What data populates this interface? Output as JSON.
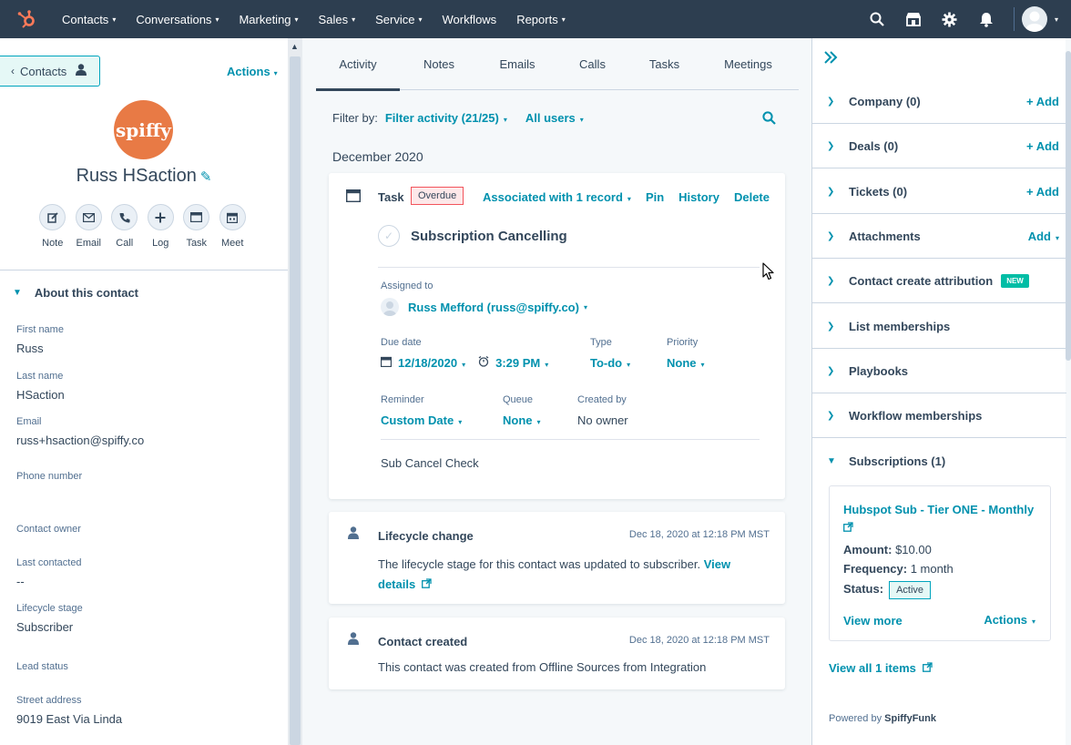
{
  "nav": {
    "items": [
      {
        "label": "Contacts",
        "dropdown": true
      },
      {
        "label": "Conversations",
        "dropdown": true
      },
      {
        "label": "Marketing",
        "dropdown": true
      },
      {
        "label": "Sales",
        "dropdown": true
      },
      {
        "label": "Service",
        "dropdown": true
      },
      {
        "label": "Workflows",
        "dropdown": false
      },
      {
        "label": "Reports",
        "dropdown": true
      }
    ],
    "colors": {
      "bg": "#2d3e50",
      "logo": "#ff7a59"
    }
  },
  "left": {
    "back_label": "Contacts",
    "actions_label": "Actions",
    "logo_text": "spiffy",
    "contact_name": "Russ HSaction",
    "quick_actions": [
      {
        "label": "Note",
        "icon": "edit-icon"
      },
      {
        "label": "Email",
        "icon": "email-icon"
      },
      {
        "label": "Call",
        "icon": "phone-icon"
      },
      {
        "label": "Log",
        "icon": "plus-icon"
      },
      {
        "label": "Task",
        "icon": "task-icon"
      },
      {
        "label": "Meet",
        "icon": "calendar-icon"
      }
    ],
    "about_title": "About this contact",
    "fields": [
      {
        "label": "First name",
        "value": "Russ"
      },
      {
        "label": "Last name",
        "value": "HSaction"
      },
      {
        "label": "Email",
        "value": "russ+hsaction@spiffy.co"
      },
      {
        "label": "Phone number",
        "value": ""
      },
      {
        "label": "Contact owner",
        "value": ""
      },
      {
        "label": "Last contacted",
        "value": "--"
      },
      {
        "label": "Lifecycle stage",
        "value": "Subscriber"
      },
      {
        "label": "Lead status",
        "value": ""
      },
      {
        "label": "Street address",
        "value": "9019 East Via Linda"
      }
    ]
  },
  "middle": {
    "tabs": [
      "Activity",
      "Notes",
      "Emails",
      "Calls",
      "Tasks",
      "Meetings"
    ],
    "active_tab": "Activity",
    "filter_label": "Filter by:",
    "filter_activity": "Filter activity (21/25)",
    "filter_users": "All users",
    "month": "December 2020",
    "task": {
      "type_label": "Task",
      "badge": "Overdue",
      "associated": "Associated with 1 record",
      "pin": "Pin",
      "history": "History",
      "delete": "Delete",
      "title": "Subscription Cancelling",
      "assigned_label": "Assigned to",
      "assignee": "Russ Mefford (russ@spiffy.co)",
      "due_label": "Due date",
      "due_date": "12/18/2020",
      "due_time": "3:29 PM",
      "type_field_label": "Type",
      "type_value": "To-do",
      "priority_label": "Priority",
      "priority_value": "None",
      "reminder_label": "Reminder",
      "reminder_value": "Custom Date",
      "queue_label": "Queue",
      "queue_value": "None",
      "created_label": "Created by",
      "created_value": "No owner",
      "note": "Sub Cancel Check"
    },
    "events": [
      {
        "title": "Lifecycle change",
        "time": "Dec 18, 2020 at 12:18 PM MST",
        "body": "The lifecycle stage for this contact was updated to subscriber.",
        "link": "View details"
      },
      {
        "title": "Contact created",
        "time": "Dec 18, 2020 at 12:18 PM MST",
        "body": "This contact was created from Offline Sources from Integration",
        "link": ""
      }
    ]
  },
  "right": {
    "sections": [
      {
        "title": "Company (0)",
        "action": "+ Add",
        "expanded": false,
        "badge": ""
      },
      {
        "title": "Deals (0)",
        "action": "+ Add",
        "expanded": false,
        "badge": ""
      },
      {
        "title": "Tickets (0)",
        "action": "+ Add",
        "expanded": false,
        "badge": ""
      },
      {
        "title": "Attachments",
        "action": "Add",
        "expanded": false,
        "badge": ""
      },
      {
        "title": "Contact create attribution",
        "action": "",
        "expanded": false,
        "badge": "NEW"
      },
      {
        "title": "List memberships",
        "action": "",
        "expanded": false,
        "badge": ""
      },
      {
        "title": "Playbooks",
        "action": "",
        "expanded": false,
        "badge": ""
      },
      {
        "title": "Workflow memberships",
        "action": "",
        "expanded": false,
        "badge": ""
      },
      {
        "title": "Subscriptions (1)",
        "action": "",
        "expanded": true,
        "badge": ""
      }
    ],
    "subscription": {
      "name": "Hubspot Sub - Tier ONE - Monthly",
      "amount_label": "Amount:",
      "amount": "$10.00",
      "frequency_label": "Frequency:",
      "frequency": "1 month",
      "status_label": "Status:",
      "status": "Active",
      "view_more": "View more",
      "actions": "Actions"
    },
    "view_all": "View all 1 items",
    "powered_prefix": "Powered by",
    "powered_brand": "SpiffyFunk"
  }
}
